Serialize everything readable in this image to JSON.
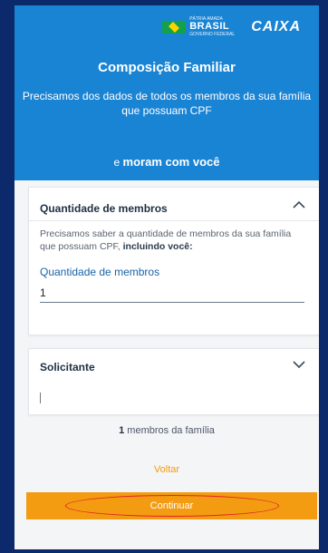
{
  "header": {
    "brasil_top": "PÁTRIA AMADA",
    "brasil_name": "BRASIL",
    "brasil_sub": "GOVERNO FEDERAL",
    "caixa": "CAIXA",
    "title": "Composição Familiar",
    "subtitle": "Precisamos dos dados de todos os membros da sua família que possuam CPF",
    "moram_prefix": "e ",
    "moram_bold": "moram com você"
  },
  "card_members": {
    "title": "Quantidade de membros",
    "desc_text": "Precisamos saber a quantidade de membros da sua família que possuam CPF, ",
    "desc_bold": "incluindo você:",
    "field_label": "Quantidade de membros",
    "field_value": "1"
  },
  "card_solicitante": {
    "title": "Solicitante"
  },
  "summary": {
    "count": "1",
    "text": " membros da família"
  },
  "actions": {
    "back": "Voltar",
    "continue": "Continuar"
  },
  "colors": {
    "header_bg": "#1a84d4",
    "accent": "#f39c12",
    "outer_bg": "#0c2a6b",
    "highlight": "#e12525"
  },
  "icons": [
    "brasil-flag-icon",
    "chevron-up-icon",
    "chevron-down-icon"
  ]
}
